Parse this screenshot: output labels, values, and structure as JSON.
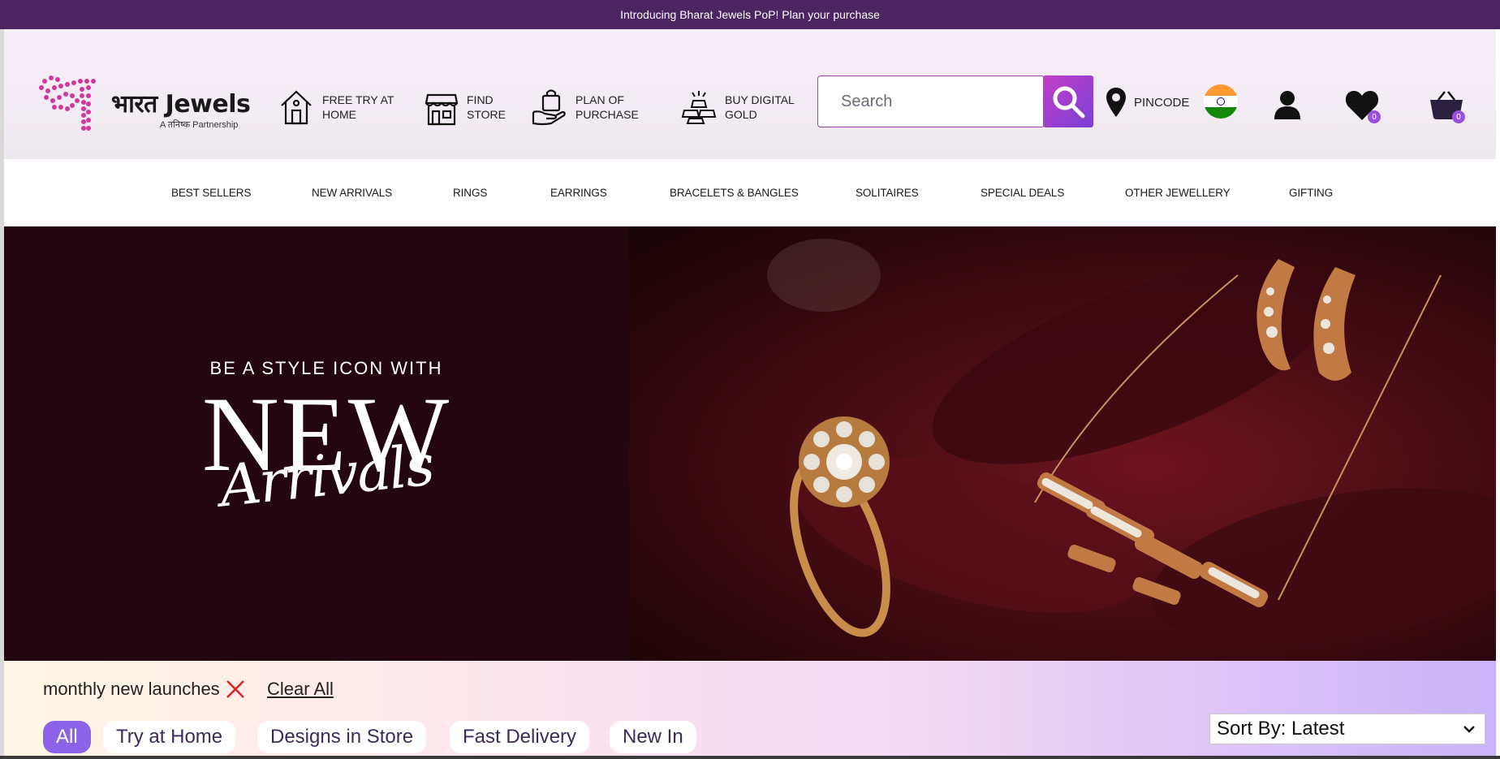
{
  "promo": {
    "text": "Introducing Bharat Jewels PoP! Plan your purchase"
  },
  "header": {
    "logo": {
      "brand": "भारत Jewels",
      "tagline": "A तनिष्क Partnership"
    },
    "items": [
      {
        "label": "FREE TRY AT HOME",
        "icon": "home-icon"
      },
      {
        "label": "FIND STORE",
        "icon": "store-icon"
      },
      {
        "label": "PLAN OF PURCHASE",
        "icon": "shopping-bag-hand-icon"
      },
      {
        "label": "BUY DIGITAL GOLD",
        "icon": "gold-bars-icon"
      }
    ],
    "search": {
      "placeholder": "Search"
    },
    "pincode": {
      "label": "PINCODE"
    },
    "wishlist_count": "0",
    "cart_count": "0"
  },
  "nav": {
    "items": [
      {
        "label": "BEST SELLERS"
      },
      {
        "label": "NEW ARRIVALS"
      },
      {
        "label": "RINGS"
      },
      {
        "label": "EARRINGS"
      },
      {
        "label": "BRACELETS & BANGLES"
      },
      {
        "label": "SOLITAIRES"
      },
      {
        "label": "SPECIAL DEALS"
      },
      {
        "label": "OTHER JEWELLERY"
      },
      {
        "label": "GIFTING"
      }
    ]
  },
  "hero": {
    "kicker": "BE A STYLE ICON WITH",
    "headline": "NEW",
    "script": "Arrivals"
  },
  "filters": {
    "applied": "monthly new launches",
    "clear_all": "Clear All",
    "chips": [
      {
        "label": "All",
        "active": true
      },
      {
        "label": "Try at Home"
      },
      {
        "label": "Designs in Store"
      },
      {
        "label": "Fast Delivery"
      },
      {
        "label": "New In"
      }
    ],
    "sort": {
      "label": "Sort By: Latest"
    }
  },
  "colors": {
    "promo_bg": "#4b2460",
    "accent_purple": "#8a63e8",
    "search_border": "#a23fb8",
    "hero_bg": "#230610",
    "close_red": "#e02020"
  }
}
